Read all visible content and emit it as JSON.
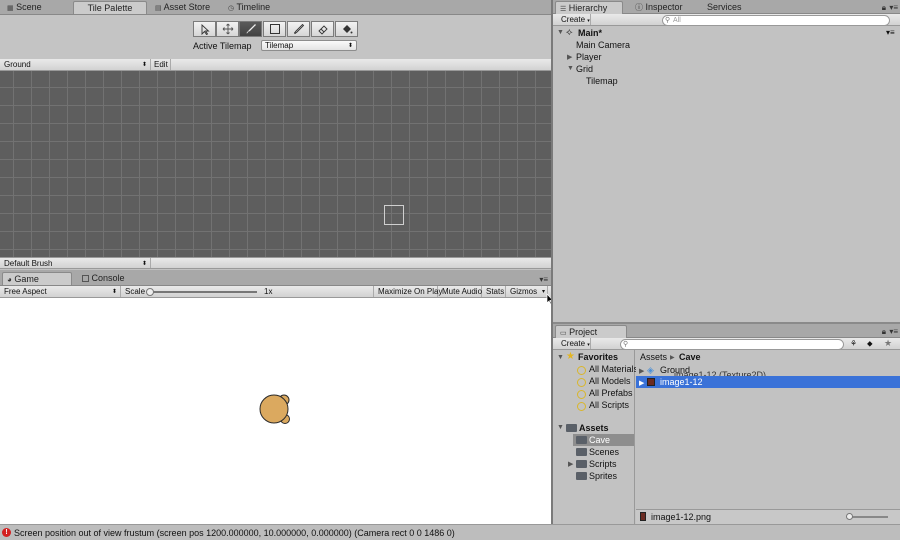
{
  "top_tabs": {
    "scene": "Scene",
    "tile_palette": "Tile Palette",
    "asset_store": "Asset Store",
    "timeline": "Timeline"
  },
  "palette": {
    "active_tilemap_label": "Active Tilemap",
    "active_tilemap_value": "Tilemap",
    "palette_select": "Ground",
    "edit_button": "Edit",
    "brush_select": "Default Brush",
    "tools": [
      "select-tool",
      "move-tool",
      "paint-tool",
      "box-fill-tool",
      "picker-tool",
      "eraser-tool",
      "fill-tool"
    ],
    "selected_tool": "paint-tool"
  },
  "game": {
    "tab_game": "Game",
    "tab_console": "Console",
    "aspect": "Free Aspect",
    "scale_label": "Scale",
    "scale_value": "1x",
    "maximize": "Maximize On Play",
    "mute": "Mute Audio",
    "stats": "Stats",
    "gizmos": "Gizmos",
    "background": "#ffffff",
    "player_color": "#dba95f"
  },
  "right_tabs": {
    "hierarchy": "Hierarchy",
    "inspector": "Inspector",
    "services": "Services"
  },
  "hierarchy": {
    "create": "Create",
    "search_placeholder": "All",
    "scene": "Main*",
    "items": [
      "Main Camera",
      "Player",
      "Grid",
      "Tilemap"
    ]
  },
  "project": {
    "tab": "Project",
    "create": "Create",
    "favorites_label": "Favorites",
    "favorites": [
      "All Materials",
      "All Models",
      "All Prefabs",
      "All Scripts"
    ],
    "assets_label": "Assets",
    "folders": [
      "Cave",
      "Scenes",
      "Scripts",
      "Sprites"
    ],
    "breadcrumb_root": "Assets",
    "breadcrumb_current": "Cave",
    "files": [
      "Ground",
      "image1-12"
    ],
    "tooltip": "image1-12 (Texture2D)",
    "selected_file_path": "image1-12.png"
  },
  "status": {
    "message": "Screen position out of view frustum (screen pos 1200.000000, 10.000000, 0.000000) (Camera rect 0 0 1486 0)",
    "error_color": "#d32020"
  }
}
